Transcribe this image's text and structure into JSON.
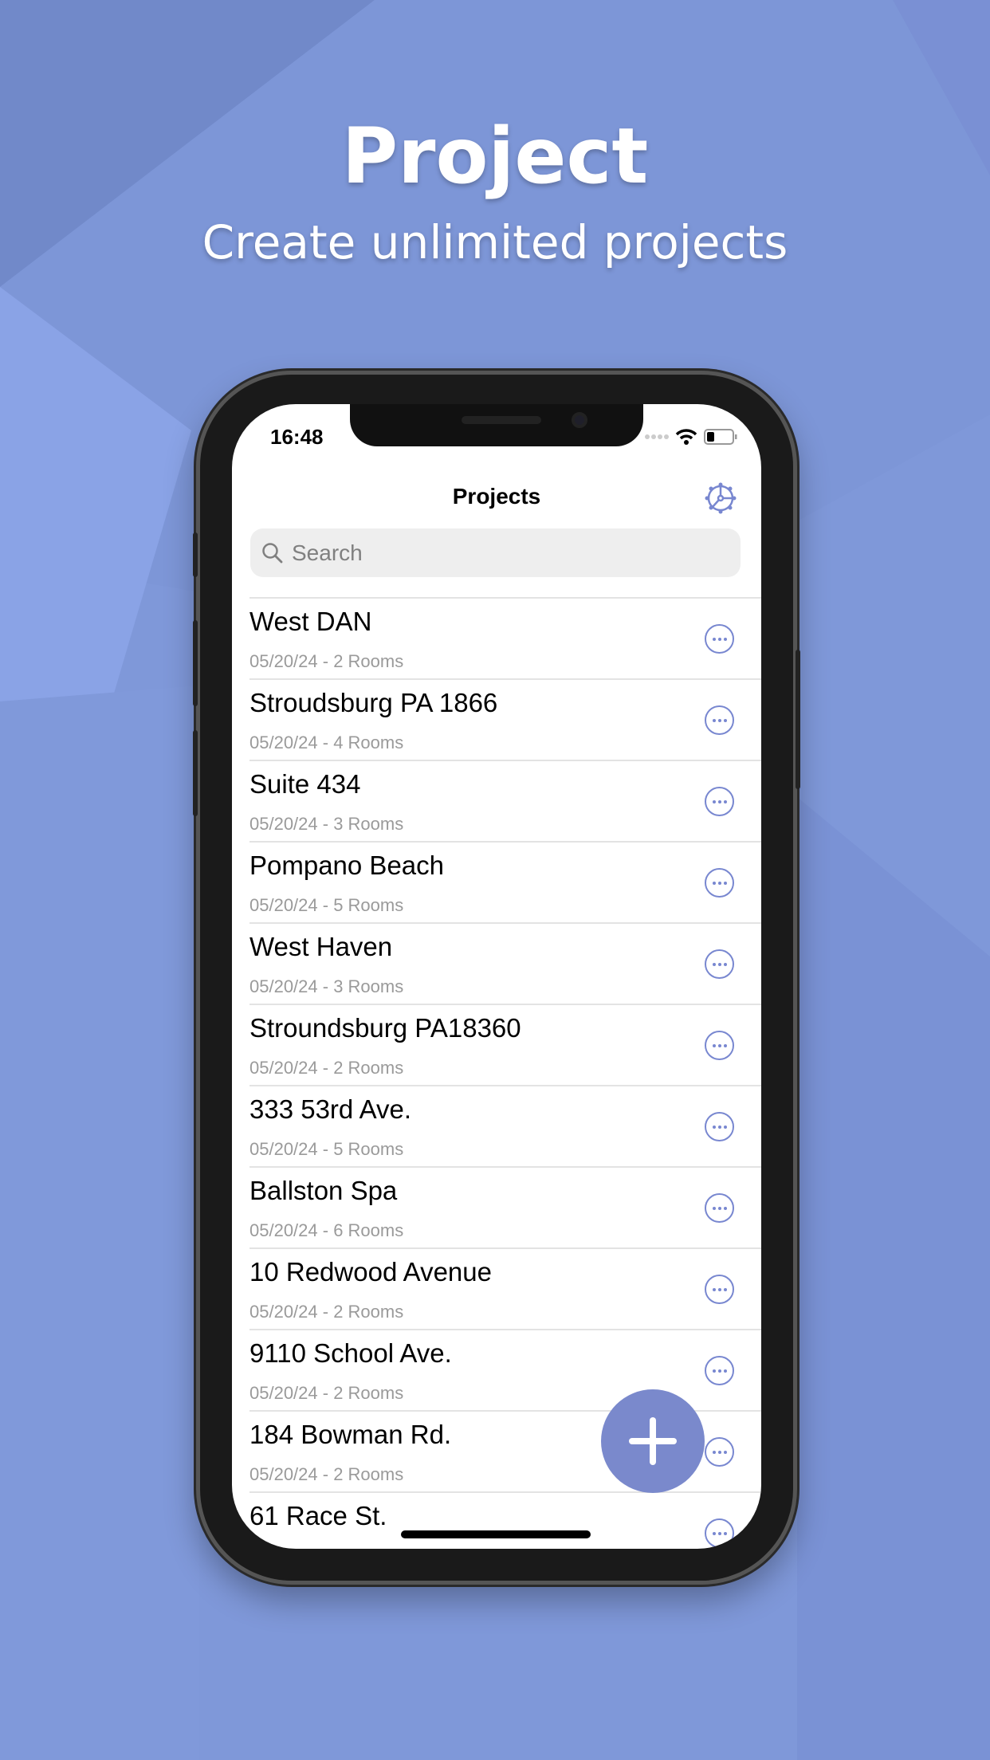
{
  "hero": {
    "title": "Project",
    "subtitle": "Create unlimited projects"
  },
  "colors": {
    "background": "#7f98d9",
    "accent": "#7887d0",
    "fab": "#7a89cc"
  },
  "status_bar": {
    "time": "16:48",
    "icons": [
      "signal-dots-icon",
      "wifi-icon",
      "battery-low-icon"
    ]
  },
  "nav": {
    "title": "Projects",
    "settings_icon": "gear-icon"
  },
  "search": {
    "placeholder": "Search",
    "value": ""
  },
  "projects": [
    {
      "name": "West DAN",
      "meta": "05/20/24 - 2 Rooms"
    },
    {
      "name": "Stroudsburg PA 1866",
      "meta": "05/20/24 - 4 Rooms"
    },
    {
      "name": "Suite 434",
      "meta": "05/20/24 - 3 Rooms"
    },
    {
      "name": "Pompano Beach",
      "meta": "05/20/24 - 5 Rooms"
    },
    {
      "name": "West Haven",
      "meta": "05/20/24 - 3 Rooms"
    },
    {
      "name": "Stroundsburg PA18360",
      "meta": "05/20/24 - 2 Rooms"
    },
    {
      "name": "333 53rd Ave.",
      "meta": "05/20/24 - 5 Rooms"
    },
    {
      "name": "Ballston Spa",
      "meta": "05/20/24 - 6 Rooms"
    },
    {
      "name": "10 Redwood Avenue",
      "meta": "05/20/24 - 2 Rooms"
    },
    {
      "name": "9110 School Ave.",
      "meta": "05/20/24 - 2 Rooms"
    },
    {
      "name": "184 Bowman Rd.",
      "meta": "05/20/24 - 2 Rooms"
    },
    {
      "name": "61 Race St.",
      "meta": ""
    }
  ]
}
